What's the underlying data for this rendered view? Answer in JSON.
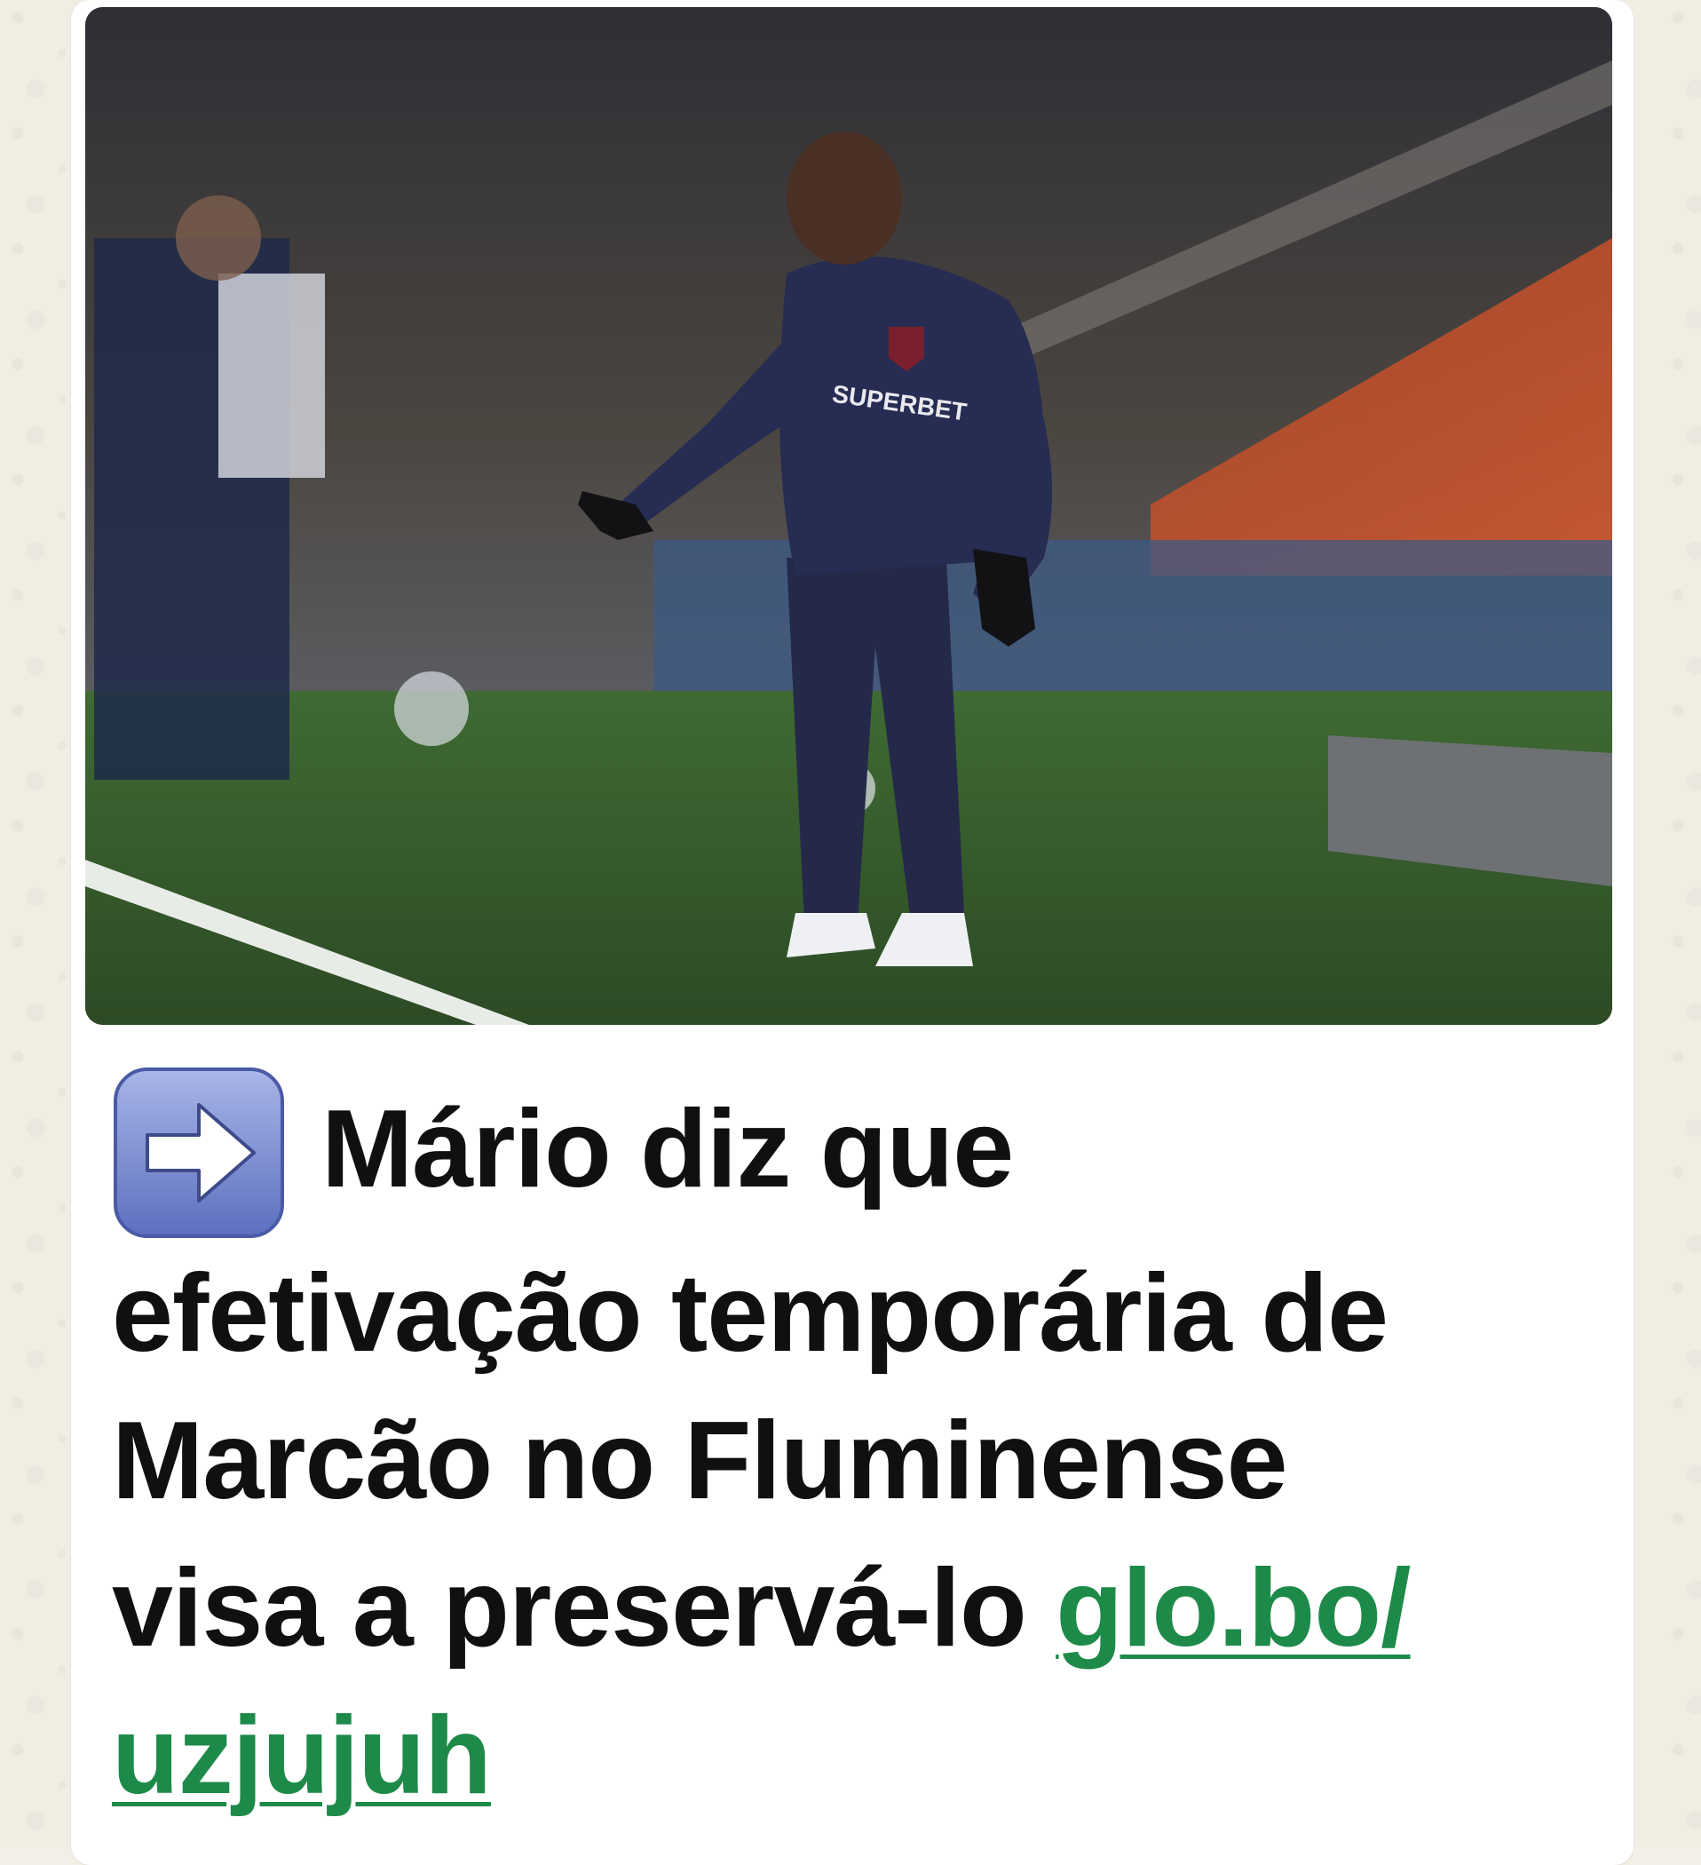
{
  "message": {
    "headline_emoji": "right-arrow-emoji",
    "headline_lines": [
      "Mário diz que",
      "efetivação temporária de",
      "Marcão no Fluminense",
      "visa a preservá-lo "
    ],
    "link_part1": "glo.bo/",
    "link_part2": "uzjujuh",
    "image": {
      "shirt_text": "SUPERBET"
    }
  },
  "colors": {
    "bubble": "#ffffff",
    "text": "#101012",
    "link": "#1e8a4a",
    "wallpaper": "#f1ede3"
  }
}
